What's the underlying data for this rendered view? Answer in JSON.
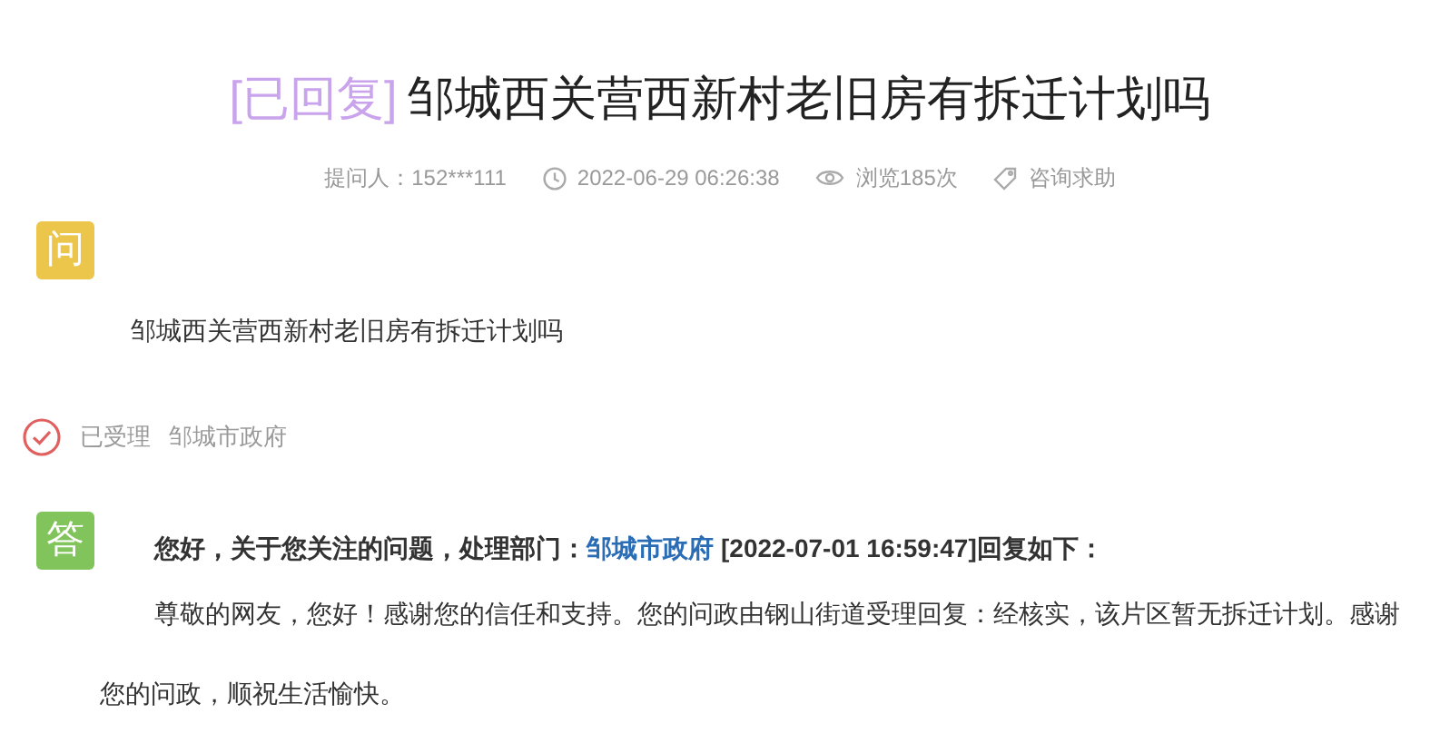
{
  "title": {
    "status": "[已回复]",
    "text": "邹城西关营西新村老旧房有拆迁计划吗"
  },
  "meta": [
    {
      "kind": "asker",
      "text": "提问人：152***111"
    },
    {
      "kind": "time",
      "text": "2022-06-29 06:26:38"
    },
    {
      "kind": "views",
      "text": "浏览185次"
    },
    {
      "kind": "category",
      "text": "咨询求助"
    }
  ],
  "question": {
    "badge": "问",
    "text": "邹城西关营西新村老旧房有拆迁计划吗"
  },
  "progress": {
    "status": "已受理",
    "department": "邹城市政府"
  },
  "answer": {
    "badge": "答",
    "intro": "您好，关于您关注的问题，处理部门：",
    "department": "邹城市政府",
    "time_text": "[2022-07-01 16:59:47]回复如下：",
    "body": "尊敬的网友，您好！感谢您的信任和支持。您的问政由钢山街道受理回复：经核实，该片区暂无拆迁计划。感谢您的问政，顺祝生活愉快。"
  }
}
